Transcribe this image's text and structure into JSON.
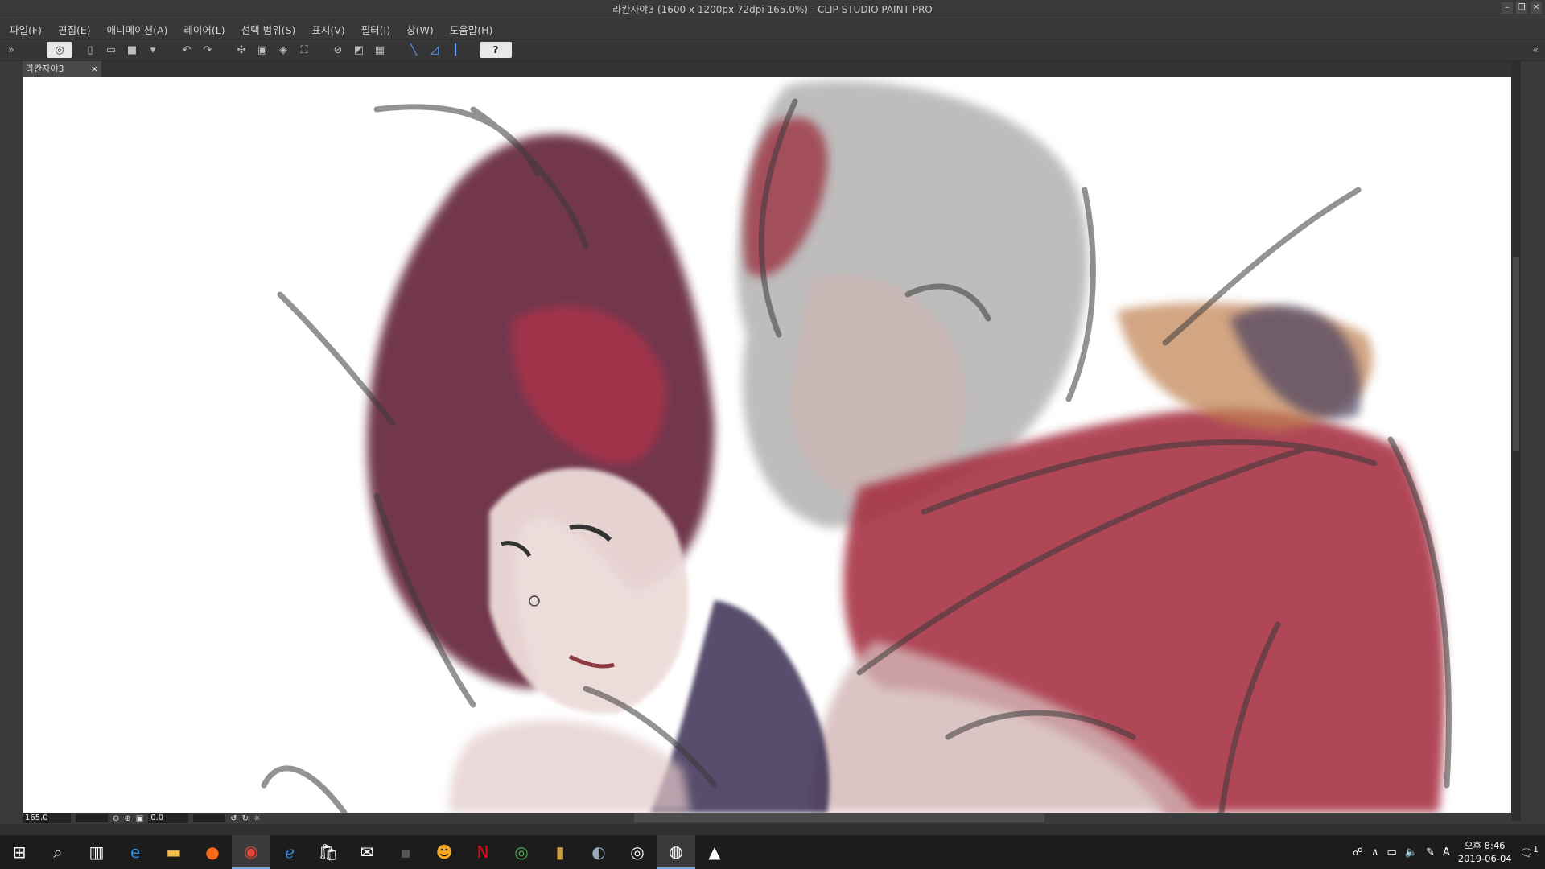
{
  "window": {
    "title": "라칸자야3 (1600 x 1200px 72dpi 165.0%)  - CLIP STUDIO PAINT PRO",
    "controls": [
      "–",
      "❐",
      "✕"
    ]
  },
  "menu": [
    "파일(F)",
    "편집(E)",
    "애니메이션(A)",
    "레이어(L)",
    "선택 범위(S)",
    "표시(V)",
    "필터(I)",
    "창(W)",
    "도움말(H)"
  ],
  "toolbar": {
    "logo_icon": "clip-studio-logo",
    "help_label": "?"
  },
  "document": {
    "tab_label": "라칸자야3",
    "close_label": "×"
  },
  "status": {
    "zoom": "165.0",
    "rotation": "0.0"
  },
  "taskbar": {
    "apps": [
      "start",
      "search",
      "task-view",
      "edge",
      "explorer",
      "origin",
      "chrome",
      "ie",
      "store",
      "mail",
      "app",
      "kakao",
      "netflix",
      "xbox",
      "files",
      "steam",
      "csp",
      "csp-active",
      "photos"
    ],
    "clock_ampm_time": "오후 8:46",
    "clock_date": "2019-06-04",
    "ime": "A",
    "notifications": "1"
  },
  "colors": {
    "ui_bg": "#383838",
    "canvas": "#ffffff",
    "hair_red": "#8a2a45",
    "cloth_red": "#a83040",
    "shirt_purple": "#4a3a5a"
  }
}
